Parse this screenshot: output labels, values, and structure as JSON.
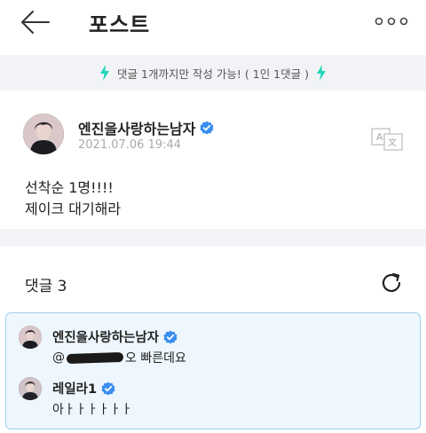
{
  "header": {
    "title": "포스트",
    "back_icon": "arrow-left-icon",
    "more_icon": "more-horizontal-icon"
  },
  "notice": {
    "text": "댓글 1개까지만 작성 가능! ( 1인 1댓글 )",
    "icon": "lightning-icon",
    "accent_color": "#1fd6b8"
  },
  "post": {
    "author": "엔진을사랑하는남자",
    "timestamp": "2021.07.06 19:44",
    "body_lines": [
      "선착순 1명!!!!",
      "제이크 대기해라"
    ],
    "translate_icon": "translate-icon"
  },
  "comments": {
    "title": "댓글 3",
    "refresh_icon": "refresh-icon",
    "items": [
      {
        "author": "엔진을사랑하는남자",
        "prefix": "@",
        "text": "오 빠른데요"
      },
      {
        "author": "레일라1",
        "text": "아ㅏㅏㅏㅏㅏㅏ"
      }
    ]
  },
  "colors": {
    "verified": "#3b8ef0",
    "highlight_bg": "#eef7fd",
    "highlight_border": "#9fd0f0"
  }
}
